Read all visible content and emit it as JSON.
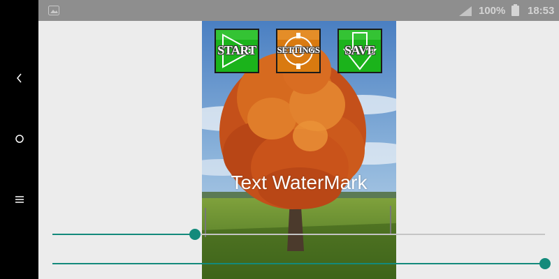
{
  "nav": {
    "back_icon": "chevron-left-icon",
    "home_icon": "circle-home-icon",
    "recents_icon": "menu-lines-icon"
  },
  "status_bar": {
    "battery_percent": "100%",
    "time": "18:53",
    "icons": [
      "gallery-icon",
      "signal-icon",
      "battery-icon"
    ]
  },
  "toolbar": {
    "start_label": "START",
    "settings_label": "SETTINGS",
    "save_label": "SAVE",
    "colors": {
      "start": "#1bb31b",
      "settings": "#d97a10",
      "save": "#1bb31b"
    }
  },
  "watermark": {
    "text": "Text WaterMark"
  },
  "sliders": [
    {
      "name": "slider-1",
      "value": 0.29
    },
    {
      "name": "slider-2",
      "value": 1.0
    }
  ],
  "accent_color": "#138a7b"
}
